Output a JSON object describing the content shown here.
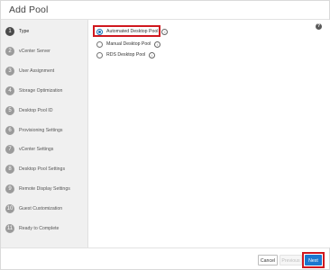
{
  "dialog": {
    "title": "Add Pool"
  },
  "sidebar": {
    "steps": [
      {
        "num": "1",
        "label": "Type"
      },
      {
        "num": "2",
        "label": "vCenter Server"
      },
      {
        "num": "3",
        "label": "User Assignment"
      },
      {
        "num": "4",
        "label": "Storage Optimization"
      },
      {
        "num": "5",
        "label": "Desktop Pool ID"
      },
      {
        "num": "6",
        "label": "Provisioning Settings"
      },
      {
        "num": "7",
        "label": "vCenter Settings"
      },
      {
        "num": "8",
        "label": "Desktop Pool Settings"
      },
      {
        "num": "9",
        "label": "Remote Display Settings"
      },
      {
        "num": "10",
        "label": "Guest Customization"
      },
      {
        "num": "11",
        "label": "Ready to Complete"
      }
    ]
  },
  "pool_type": {
    "options": [
      {
        "label": "Automated Desktop Pool",
        "selected": true
      },
      {
        "label": "Manual Desktop Pool",
        "selected": false
      },
      {
        "label": "RDS Desktop Pool",
        "selected": false
      }
    ],
    "info_icon": "i",
    "help_icon": "?"
  },
  "footer": {
    "cancel_label": "Cancel",
    "previous_label": "Previous",
    "next_label": "Next"
  },
  "colors": {
    "accent": "#1b78d0",
    "highlight": "#d0181f"
  }
}
